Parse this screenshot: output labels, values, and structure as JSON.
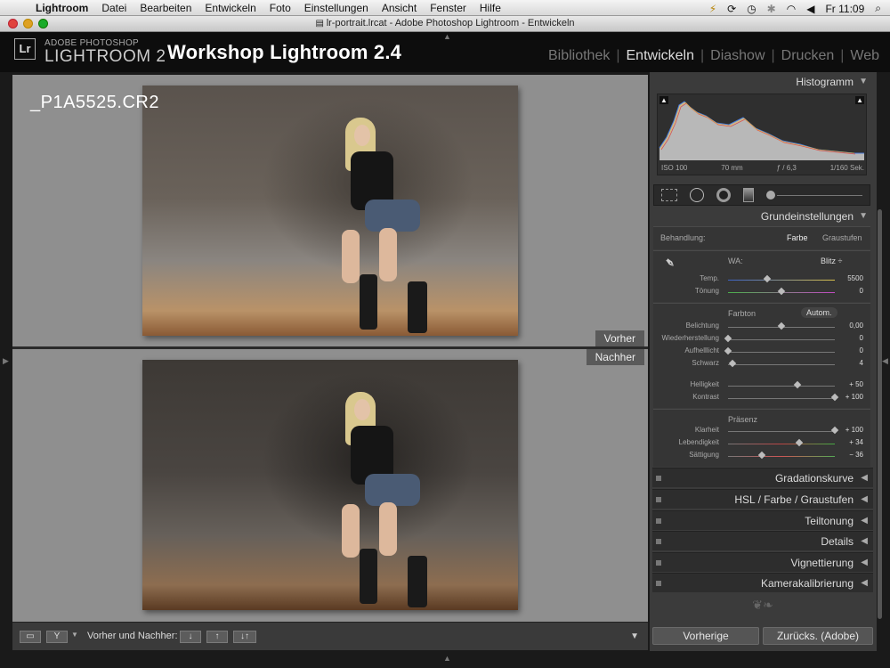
{
  "menubar": {
    "items": [
      "Lightroom",
      "Datei",
      "Bearbeiten",
      "Entwickeln",
      "Foto",
      "Einstellungen",
      "Ansicht",
      "Fenster",
      "Hilfe"
    ],
    "clock": "Fr 11:09"
  },
  "window": {
    "title": "lr-portrait.lrcat - Adobe Photoshop Lightroom - Entwickeln"
  },
  "identity": {
    "logo": "Lr",
    "product_small": "ADOBE PHOTOSHOP",
    "product_big": "LIGHTROOM 2",
    "plate": "Workshop Lightroom 2.4",
    "modules": [
      "Bibliothek",
      "Entwickeln",
      "Diashow",
      "Drucken",
      "Web"
    ]
  },
  "view": {
    "filename": "_P1A5525.CR2",
    "before_label": "Vorher",
    "after_label": "Nachher"
  },
  "toolbar": {
    "before_after_label": "Vorher und Nachher:"
  },
  "panels": {
    "histogram": {
      "title": "Histogramm",
      "iso": "ISO 100",
      "focal": "70 mm",
      "aperture": "ƒ / 6,3",
      "shutter": "1/160 Sek."
    },
    "basic": {
      "title": "Grundeinstellungen",
      "treatment_label": "Behandlung:",
      "treatment_color": "Farbe",
      "treatment_gray": "Graustufen",
      "wb_label": "WA:",
      "wb_value": "Blitz ÷",
      "tone_label": "Farbton",
      "auto_label": "Autom.",
      "presence_label": "Präsenz",
      "sliders": [
        {
          "label": "Temp.",
          "value": "5500",
          "pos": 0.37
        },
        {
          "label": "Tönung",
          "value": "0",
          "pos": 0.5
        },
        {
          "label": "Belichtung",
          "value": "0,00",
          "pos": 0.5
        },
        {
          "label": "Wiederherstellung",
          "value": "0",
          "pos": 0.0
        },
        {
          "label": "Aufhelllicht",
          "value": "0",
          "pos": 0.0
        },
        {
          "label": "Schwarz",
          "value": "4",
          "pos": 0.04
        },
        {
          "label": "Helligkeit",
          "value": "+ 50",
          "pos": 0.65
        },
        {
          "label": "Kontrast",
          "value": "+ 100",
          "pos": 1.0
        },
        {
          "label": "Klarheit",
          "value": "+ 100",
          "pos": 1.0
        },
        {
          "label": "Lebendigkeit",
          "value": "+ 34",
          "pos": 0.67
        },
        {
          "label": "Sättigung",
          "value": "− 36",
          "pos": 0.32
        }
      ]
    },
    "collapsed": [
      {
        "title": "Gradationskurve"
      },
      {
        "title": "HSL / Farbe / Graustufen"
      },
      {
        "title": "Teiltonung"
      },
      {
        "title": "Details"
      },
      {
        "title": "Vignettierung"
      },
      {
        "title": "Kamerakalibrierung"
      }
    ],
    "buttons": {
      "previous": "Vorherige",
      "reset": "Zurücks. (Adobe)"
    }
  }
}
